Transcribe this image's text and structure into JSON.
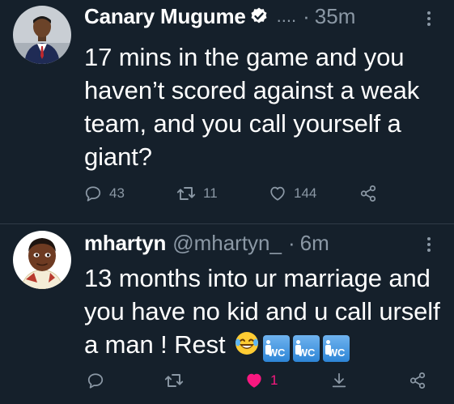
{
  "tweets": [
    {
      "author_name": "Canary Mugume",
      "verified": true,
      "handle": "....",
      "dot": "·",
      "time": "35m",
      "text": "17 mins in the game and you haven’t scored against a weak team, and you call yourself a giant?",
      "reply_count": "43",
      "retweet_count": "11",
      "like_count": "144",
      "liked": false
    },
    {
      "author_name": "mhartyn",
      "verified": false,
      "handle": "@mhartyn_",
      "dot": "·",
      "time": "6m",
      "text": "13 months into ur marriage and you have no kid and u call urself a man ! Rest",
      "reply_count": "",
      "retweet_count": "",
      "like_count": "1",
      "liked": true,
      "emojis": [
        "laughing-tears-emoji",
        "restroom-icon",
        "restroom-icon",
        "restroom-icon"
      ]
    }
  ],
  "colors": {
    "background": "#15202b",
    "text_primary": "#ffffff",
    "text_secondary": "#8b98a5",
    "like_active": "#f91880",
    "verified_badge": "#ffffff"
  },
  "icons": {
    "reply": "reply-icon",
    "retweet": "retweet-icon",
    "like": "heart-icon",
    "share": "share-icon",
    "download": "download-icon",
    "more": "more-vertical-icon",
    "verified": "verified-badge-icon"
  }
}
